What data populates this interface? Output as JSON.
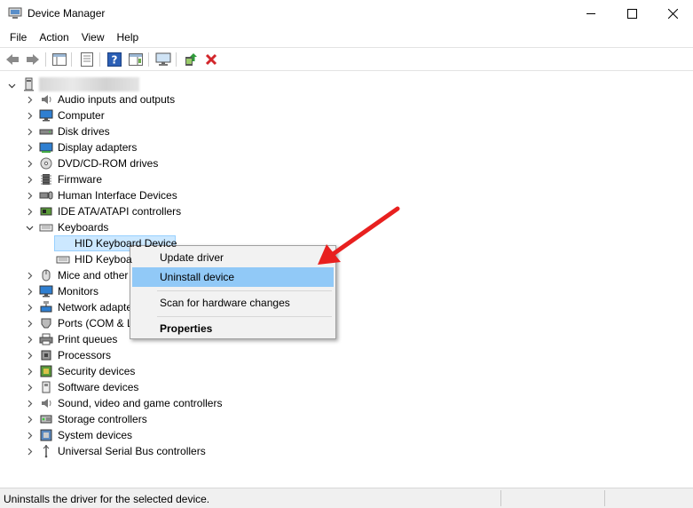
{
  "window": {
    "title": "Device Manager"
  },
  "menu": [
    "File",
    "Action",
    "View",
    "Help"
  ],
  "tree": {
    "categories": [
      {
        "label": "Audio inputs and outputs",
        "icon": "speaker-icon"
      },
      {
        "label": "Computer",
        "icon": "monitor-icon"
      },
      {
        "label": "Disk drives",
        "icon": "disk-drive-icon"
      },
      {
        "label": "Display adapters",
        "icon": "display-adapter-icon"
      },
      {
        "label": "DVD/CD-ROM drives",
        "icon": "dvd-drive-icon"
      },
      {
        "label": "Firmware",
        "icon": "firmware-icon"
      },
      {
        "label": "Human Interface Devices",
        "icon": "hid-icon"
      },
      {
        "label": "IDE ATA/ATAPI controllers",
        "icon": "ide-controller-icon"
      },
      {
        "label": "Keyboards",
        "icon": "keyboard-icon",
        "expanded": true
      },
      {
        "label": "Mice and other",
        "icon": "mouse-icon"
      },
      {
        "label": "Monitors",
        "icon": "monitor-icon"
      },
      {
        "label": "Network adapte",
        "icon": "network-adapter-icon"
      },
      {
        "label": "Ports (COM & L",
        "icon": "port-icon"
      },
      {
        "label": "Print queues",
        "icon": "printer-icon"
      },
      {
        "label": "Processors",
        "icon": "processor-icon"
      },
      {
        "label": "Security devices",
        "icon": "security-device-icon"
      },
      {
        "label": "Software devices",
        "icon": "software-device-icon"
      },
      {
        "label": "Sound, video and game controllers",
        "icon": "sound-icon"
      },
      {
        "label": "Storage controllers",
        "icon": "storage-controller-icon"
      },
      {
        "label": "System devices",
        "icon": "system-device-icon"
      },
      {
        "label": "Universal Serial Bus controllers",
        "icon": "usb-icon"
      }
    ],
    "keyboard_children": [
      "HID Keyboard Device",
      "HID Keyboa"
    ]
  },
  "context_menu": {
    "update": "Update driver",
    "uninstall": "Uninstall device",
    "scan": "Scan for hardware changes",
    "properties": "Properties"
  },
  "status": {
    "text": "Uninstalls the driver for the selected device."
  },
  "annotation": {
    "arrow_color": "#e8201f"
  }
}
